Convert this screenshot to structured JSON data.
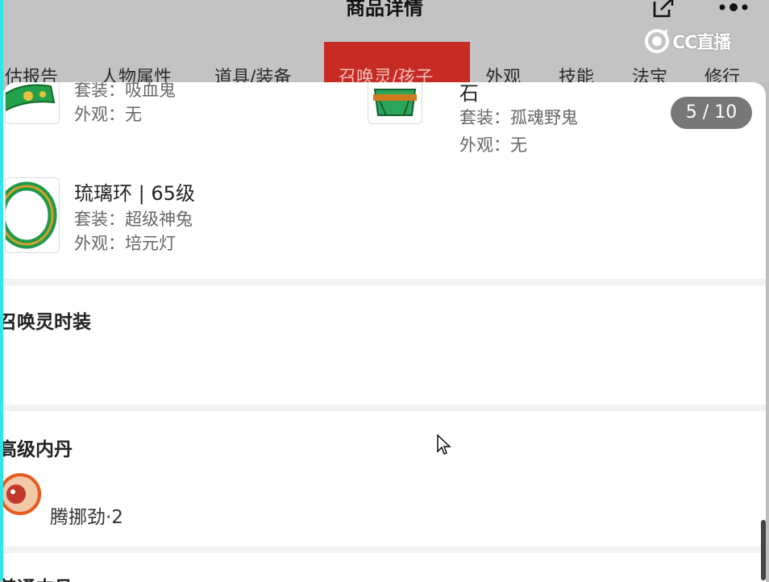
{
  "header": {
    "title": "商品详情",
    "share_icon": "share-icon",
    "more_icon": "more-icon"
  },
  "watermark": {
    "text": "CC直播"
  },
  "tabs": [
    {
      "label": "估报告",
      "active": false
    },
    {
      "label": "人物属性",
      "active": false
    },
    {
      "label": "道具/装备",
      "active": false
    },
    {
      "label": "召唤灵/孩子",
      "active": true
    },
    {
      "label": "外观",
      "active": false
    },
    {
      "label": "技能",
      "active": false
    },
    {
      "label": "法宝",
      "active": false
    },
    {
      "label": "修行",
      "active": false
    }
  ],
  "colors": {
    "active_tab": "#c62b24",
    "badge": "#777777"
  },
  "items": [
    {
      "name": "",
      "set": "套装：吸血鬼",
      "look": "外观：无",
      "icon": "jade-belt-icon"
    },
    {
      "name": "石",
      "set": "套装：孤魂野鬼",
      "look": "外观：无",
      "icon": "jade-armor-icon"
    },
    {
      "name": "琉璃环 | 65级",
      "set": "套装：超级神兔",
      "look": "外观：培元灯",
      "icon": "jade-ring-icon"
    }
  ],
  "pager": {
    "current": 5,
    "total": 10,
    "label": "5 / 10"
  },
  "sections": {
    "summon_fashion": {
      "title": "召唤灵时装"
    },
    "advanced_neidan": {
      "title": "高级内丹",
      "item": "腾挪劲·2",
      "icon": "neidan-icon"
    },
    "normal_neidan": {
      "title": "普通内丹"
    }
  }
}
